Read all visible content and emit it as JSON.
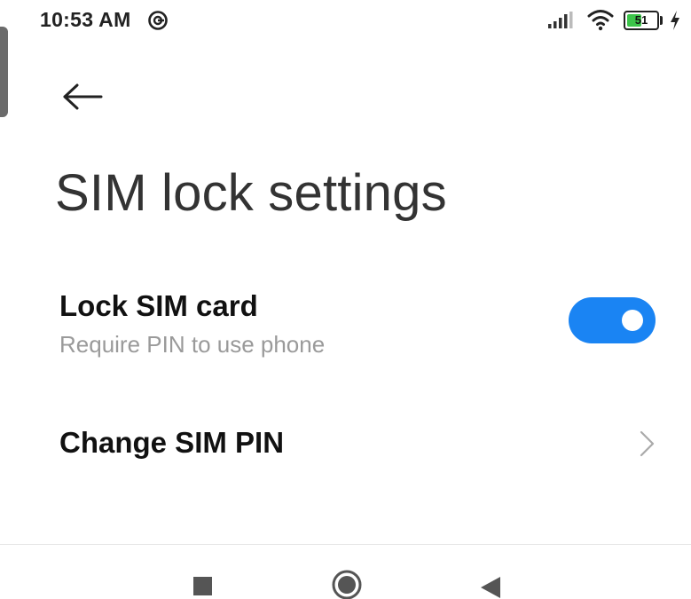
{
  "status_bar": {
    "time": "10:53 AM",
    "battery_level": "51",
    "battery_fraction": 0.51,
    "icons": [
      "notification-icon",
      "signal-icon",
      "wifi-icon",
      "battery-icon",
      "charging-icon"
    ]
  },
  "header": {
    "title": "SIM lock settings",
    "back_icon": "back-arrow-icon"
  },
  "settings": {
    "lock_sim": {
      "title": "Lock SIM card",
      "subtitle": "Require PIN to use phone",
      "enabled": true
    },
    "change_pin": {
      "title": "Change SIM PIN",
      "icon": "chevron-right-icon"
    }
  },
  "nav_bar": {
    "buttons": [
      "recents-button",
      "home-button",
      "back-button"
    ]
  },
  "colors": {
    "accent": "#1a84f3",
    "title_text": "#333333",
    "subtitle_text": "#9a9a9a",
    "battery_fill": "#3cc44a"
  }
}
